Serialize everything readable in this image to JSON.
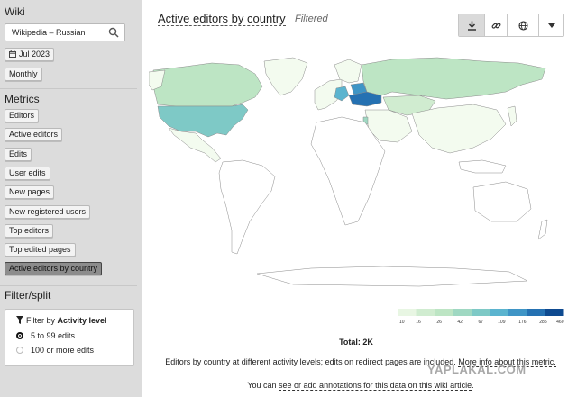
{
  "sidebar": {
    "wiki_title": "Wiki",
    "wiki_selected": "Wikipedia – Russian",
    "date_chip": "Jul 2023",
    "granularity_chip": "Monthly",
    "metrics_title": "Metrics",
    "metrics": [
      "Editors",
      "Active editors",
      "Edits",
      "User edits",
      "New pages",
      "New registered users",
      "Top editors",
      "Top edited pages",
      "Active editors by country"
    ],
    "active_metric_index": 8,
    "filter_title": "Filter/split",
    "filter_label_prefix": "Filter by",
    "filter_label_field": "Activity level",
    "filter_options": [
      "5 to 99 edits",
      "100 or more edits"
    ],
    "filter_selected_index": 0
  },
  "main": {
    "title": "Active editors by country",
    "subtitle": "Filtered",
    "total": "Total: 2K",
    "description_pre": "Editors by country at different activity levels; edits on redirect pages are included. ",
    "description_link": "More info about this metric.",
    "annotation_pre": "You can ",
    "annotation_link": "see or add annotations for this data on this wiki article",
    "annotation_post": "."
  },
  "toolbar": {
    "icons": [
      "download-icon",
      "link-icon",
      "globe-icon",
      "caret-down-icon"
    ]
  },
  "legend": {
    "ticks": [
      "10",
      "16",
      "26",
      "42",
      "67",
      "109",
      "176",
      "285",
      "460"
    ],
    "colors": [
      "#e8f6e3",
      "#d0ecd0",
      "#bde5c4",
      "#9fd8c2",
      "#7ec9c6",
      "#5bb4cf",
      "#3f95c6",
      "#2571b2",
      "#0e4a90"
    ]
  },
  "map": {
    "default_fill": "#ffffff",
    "light_fill": "#f3fbef",
    "colors": {
      "usa": "#7ec9c6",
      "canada": "#bde5c4",
      "russia": "#bde5c4",
      "ukraine": "#2571b2",
      "belarus": "#3f95c6",
      "germany": "#5bb4cf",
      "kazakhstan": "#d0ecd0",
      "israel": "#9fd8c2"
    }
  },
  "watermark": "YAPLAKAL.COM"
}
